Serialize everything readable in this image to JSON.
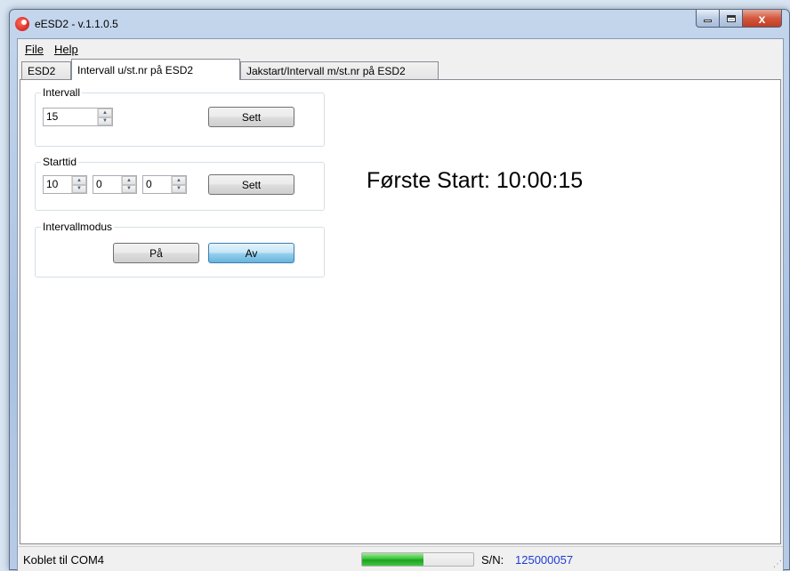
{
  "window": {
    "title": "eESD2 - v.1.1.0.5",
    "close_glyph": "x"
  },
  "menu": {
    "file": "File",
    "help": "Help"
  },
  "tabs": [
    {
      "label": "ESD2"
    },
    {
      "label": "Intervall u/st.nr på ESD2"
    },
    {
      "label": "Jakstart/Intervall m/st.nr på ESD2"
    }
  ],
  "intervall": {
    "legend": "Intervall",
    "value": "15",
    "set_label": "Sett"
  },
  "starttid": {
    "legend": "Starttid",
    "hour": "10",
    "minute": "0",
    "second": "0",
    "set_label": "Sett"
  },
  "intervallmodus": {
    "legend": "Intervallmodus",
    "on_label": "På",
    "off_label": "Av"
  },
  "first_start": "Første Start: 10:00:15",
  "status": {
    "connection": "Koblet til COM4",
    "progress": 0.55,
    "sn_label": "S/N:",
    "sn_value": "125000057"
  },
  "colors": {
    "accent": "#3c7fb1",
    "serial": "#1f3cd6",
    "progress": "#37c437"
  },
  "icons": {
    "spin_up": "up-arrow-icon",
    "spin_down": "down-arrow-icon"
  }
}
